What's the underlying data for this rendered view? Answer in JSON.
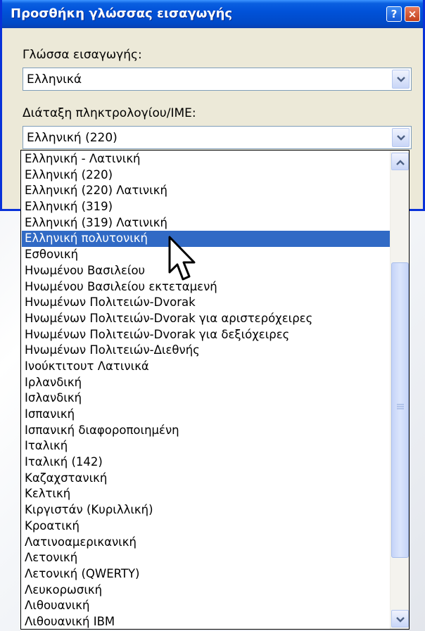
{
  "dialog": {
    "title": "Προσθήκη γλώσσας εισαγωγής",
    "help_label": "?",
    "close_label": "×",
    "input_language_label": "Γλώσσα εισαγωγής:",
    "input_language_value": "Ελληνικά",
    "keyboard_label": "Διάταξη πληκτρολογίου/IME:",
    "keyboard_value": "Ελληνική (220)"
  },
  "dropdown": {
    "selected_index": 5,
    "items": [
      "Ελληνική - Λατινική",
      "Ελληνική (220)",
      "Ελληνική (220) Λατινική",
      "Ελληνική (319)",
      "Ελληνική (319) Λατινική",
      "Ελληνική πολυτονική",
      "Εσθονική",
      "Ηνωμένου Βασιλείου",
      "Ηνωμένου Βασιλείου εκτεταμενή",
      "Ηνωμένων Πολιτειών-Dvorak",
      "Ηνωμένων Πολιτειών-Dvorak για αριστερόχειρες",
      "Ηνωμένων Πολιτειών-Dvorak για δεξιόχειρες",
      "Ηνωμένων Πολιτειών-Διεθνής",
      "Ινούκτιτουτ Λατινικά",
      "Ιρλανδική",
      "Ισλανδική",
      "Ισπανική",
      "Ισπανική διαφοροποιημένη",
      "Ιταλική",
      "Ιταλική (142)",
      "Καζαχστανική",
      "Κελτική",
      "Κιργιστάν (Κυριλλική)",
      "Κροατική",
      "Λατινοαμερικανική",
      "Λετονική",
      "Λετονική (QWERTY)",
      "Λευκορωσική",
      "Λιθουανική",
      "Λιθουανική IBM"
    ]
  },
  "icons": {
    "combo_arrow": "chevron-down-icon",
    "scroll_up": "chevron-up-icon",
    "scroll_down": "chevron-down-icon",
    "grip": "scroll-grip-icon",
    "cursor": "mouse-pointer-icon"
  },
  "colors": {
    "titlebar": "#0152d9",
    "selection": "#316ac5",
    "dialog_bg": "#ece9d8",
    "close_button": "#c3401b"
  }
}
